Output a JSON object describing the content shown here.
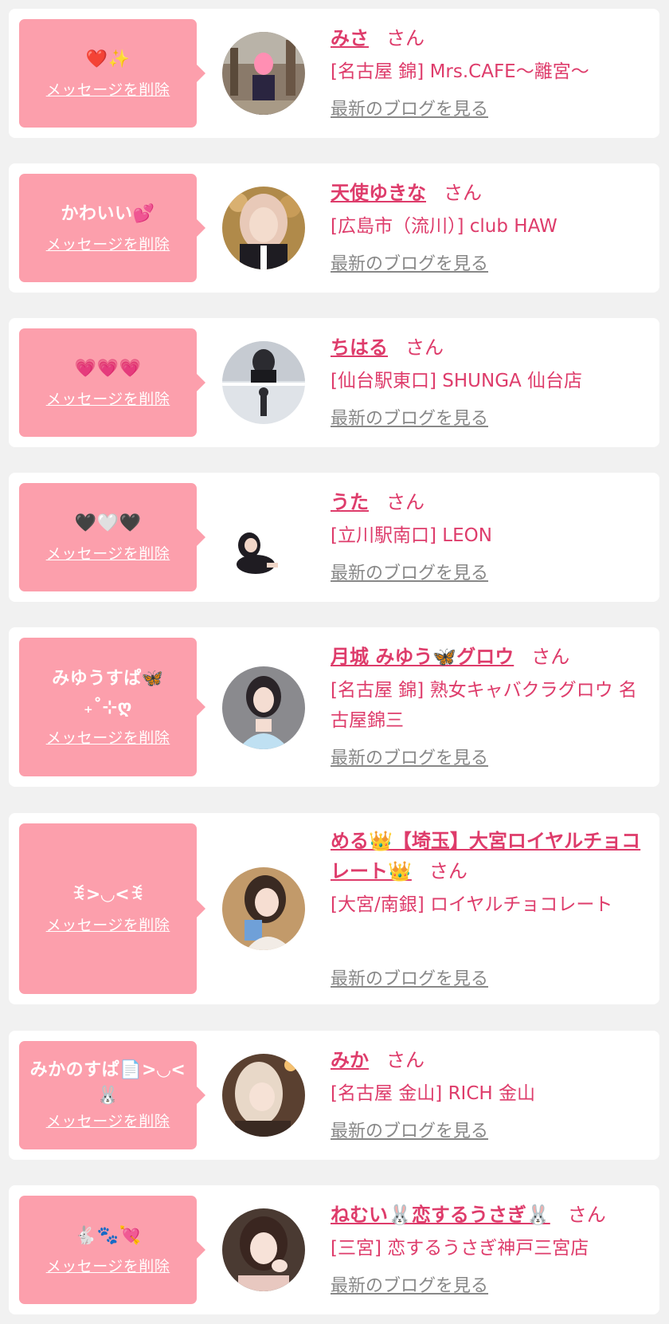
{
  "colors": {
    "bubble": "#fc9fac",
    "accent": "#de3c6b",
    "link_gray": "#888888",
    "background": "#f1f1f1"
  },
  "entries": [
    {
      "message": "❤️✨",
      "delete_label": "メッセージを削除",
      "name": "みさ",
      "honorific": "さん",
      "shop": "[名古屋 錦] Mrs.CAFE～離宮～",
      "blog_label": "最新のブログを見る"
    },
    {
      "message": "かわいい💕",
      "delete_label": "メッセージを削除",
      "name": "天使ゆきな",
      "honorific": "さん",
      "shop": "[広島市（流川）] club HAW",
      "blog_label": "最新のブログを見る"
    },
    {
      "message": "💗💗💗",
      "delete_label": "メッセージを削除",
      "name": "ちはる",
      "honorific": "さん",
      "shop": "[仙台駅東口] SHUNGA 仙台店",
      "blog_label": "最新のブログを見る"
    },
    {
      "message": "🖤🤍🖤",
      "delete_label": "メッセージを削除",
      "name": "うた",
      "honorific": "さん",
      "shop": "[立川駅南口] LEON",
      "blog_label": "最新のブログを見る"
    },
    {
      "message": "みゆうすぱ🦋 ₊˚⊹ღ",
      "delete_label": "メッセージを削除",
      "name": "月城 みゆう🦋グロウ",
      "honorific": "さん",
      "shop": "[名古屋 錦] 熟女キャバクラグロウ 名古屋錦三",
      "blog_label": "最新のブログを見る"
    },
    {
      "message": "ꉂ>◡<ꉂ",
      "delete_label": "メッセージを削除",
      "name": "める👑【埼玉】大宮ロイヤルチョコレート👑",
      "honorific": "さん",
      "shop": "[大宮/南銀] ロイヤルチョコレート",
      "blog_label": "最新のブログを見る"
    },
    {
      "message": "みかのすぱ📄>◡<🐰",
      "delete_label": "メッセージを削除",
      "name": "みか",
      "honorific": "さん",
      "shop": "[名古屋 金山] RICH 金山",
      "blog_label": "最新のブログを見る"
    },
    {
      "message": "🐇🐾💘",
      "delete_label": "メッセージを削除",
      "name": "ねむい🐰恋するうさぎ🐰",
      "honorific": "さん",
      "shop": "[三宮] 恋するうさぎ神戸三宮店",
      "blog_label": "最新のブログを見る"
    }
  ]
}
